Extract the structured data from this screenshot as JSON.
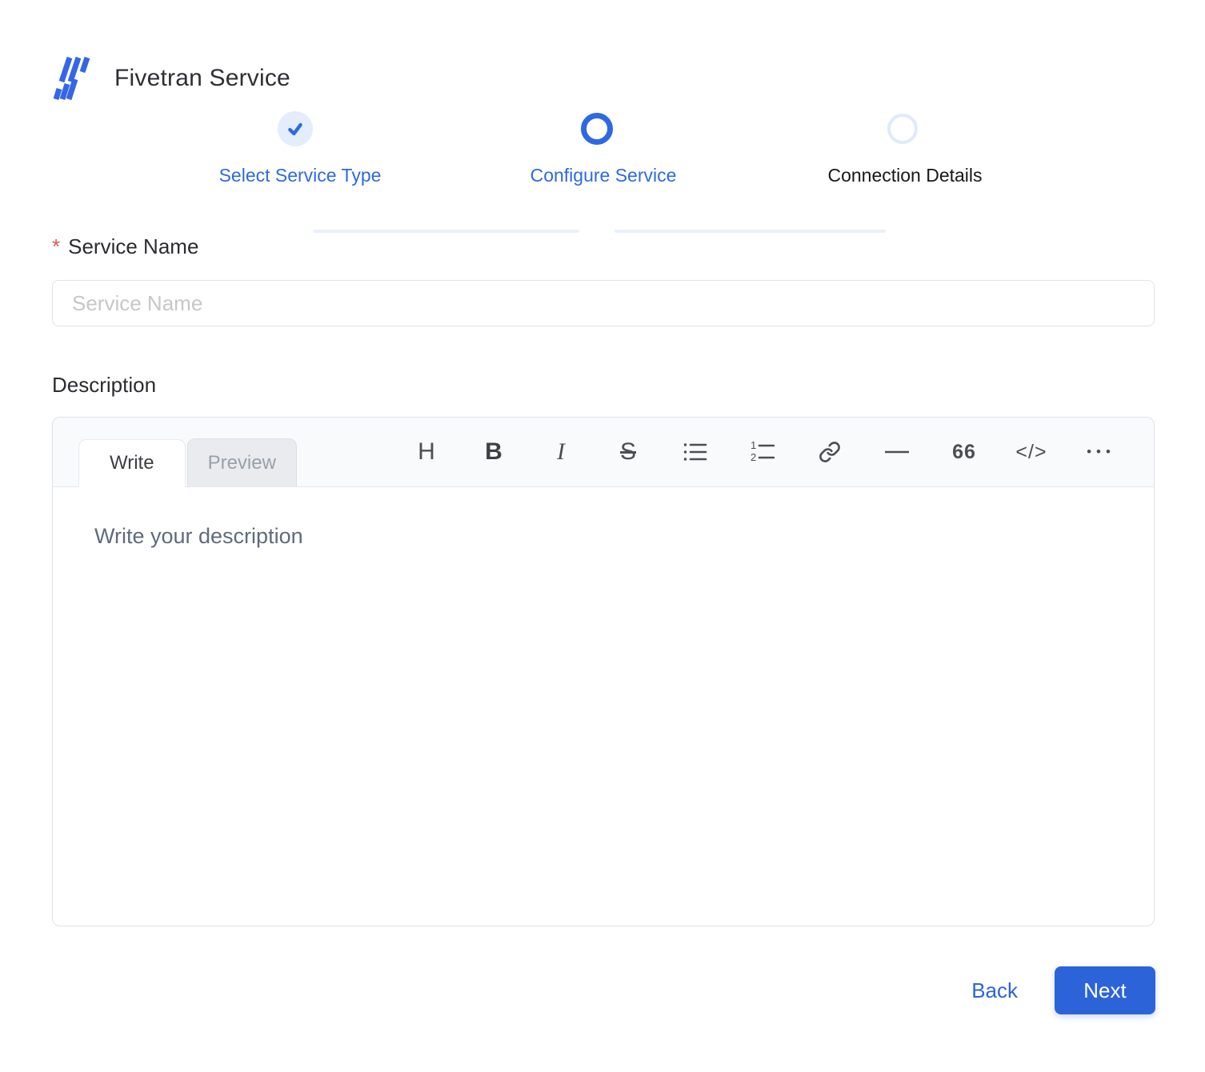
{
  "header": {
    "title": "Fivetran Service",
    "logo": "fivetran-logo"
  },
  "stepper": {
    "steps": [
      {
        "label": "Select Service Type",
        "state": "completed",
        "icon": "check-icon"
      },
      {
        "label": "Configure Service",
        "state": "active",
        "icon": "ring-icon"
      },
      {
        "label": "Connection Details",
        "state": "upcoming",
        "icon": "ring-icon"
      }
    ]
  },
  "form": {
    "service_name": {
      "label": "Service Name",
      "required_marker": "*",
      "placeholder": "Service Name",
      "value": ""
    },
    "description": {
      "label": "Description",
      "editor": {
        "tabs": [
          {
            "label": "Write",
            "active": true
          },
          {
            "label": "Preview",
            "active": false
          }
        ],
        "toolbar": [
          {
            "name": "heading-icon",
            "glyph": "H"
          },
          {
            "name": "bold-icon",
            "glyph": "B"
          },
          {
            "name": "italic-icon",
            "glyph": "I"
          },
          {
            "name": "strikethrough-icon",
            "glyph": "S"
          },
          {
            "name": "unordered-list-icon",
            "glyph": ""
          },
          {
            "name": "ordered-list-icon",
            "glyph": ""
          },
          {
            "name": "link-icon",
            "glyph": ""
          },
          {
            "name": "horizontal-rule-icon",
            "glyph": ""
          },
          {
            "name": "quote-icon",
            "glyph": "66"
          },
          {
            "name": "code-icon",
            "glyph": "</>"
          },
          {
            "name": "more-icon",
            "glyph": "•••"
          }
        ],
        "placeholder": "Write your description",
        "value": ""
      }
    }
  },
  "footer": {
    "back_label": "Back",
    "next_label": "Next"
  },
  "colors": {
    "accent_blue": "#2d63d9",
    "step_blue": "#2e6ae0",
    "step_completed_bg": "#e3edfb",
    "step_line": "#e9f0fa",
    "required_red": "#e25650",
    "placeholder_gray": "#c6c7cb",
    "editor_header_bg": "#f9fafb"
  }
}
